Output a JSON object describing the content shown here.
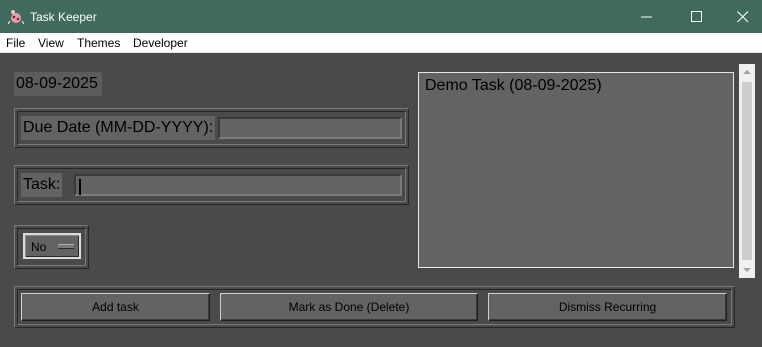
{
  "window": {
    "title": "Task Keeper",
    "icon": "bug-app-icon",
    "controls": [
      "minimize-icon",
      "maximize-icon",
      "close-icon"
    ]
  },
  "menu": {
    "items": [
      "File",
      "View",
      "Themes",
      "Developer"
    ]
  },
  "main": {
    "current_date": "08-09-2025",
    "due_date": {
      "label": "Due Date (MM-DD-YYYY):",
      "value": ""
    },
    "task": {
      "label": "Task:",
      "value": ""
    },
    "recurring_option": {
      "selected": "No"
    },
    "task_list": {
      "items": [
        "Demo Task (08-09-2025)"
      ]
    },
    "buttons": {
      "add": "Add task",
      "mark_done": "Mark as Done (Delete)",
      "dismiss": "Dismiss Recurring"
    }
  },
  "colors": {
    "titlebar": "#416a5e",
    "background": "#4a4a4a",
    "widget": "#636363"
  }
}
